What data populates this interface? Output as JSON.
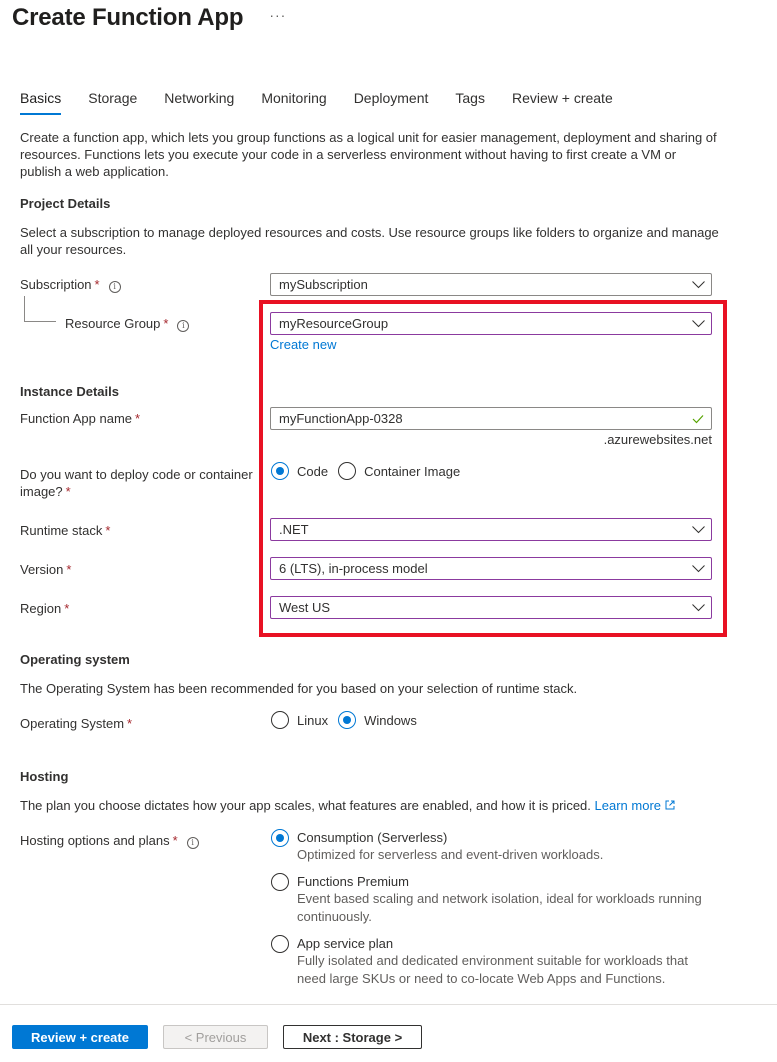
{
  "header": {
    "title": "Create Function App",
    "more_label": "···"
  },
  "tabs": [
    {
      "label": "Basics",
      "active": true
    },
    {
      "label": "Storage"
    },
    {
      "label": "Networking"
    },
    {
      "label": "Monitoring"
    },
    {
      "label": "Deployment"
    },
    {
      "label": "Tags"
    },
    {
      "label": "Review + create"
    }
  ],
  "intro": "Create a function app, which lets you group functions as a logical unit for easier management, deployment and sharing of resources. Functions lets you execute your code in a serverless environment without having to first create a VM or publish a web application.",
  "project": {
    "heading": "Project Details",
    "description": "Select a subscription to manage deployed resources and costs. Use resource groups like folders to organize and manage all your resources.",
    "subscription_label": "Subscription",
    "subscription_value": "mySubscription",
    "resource_group_label": "Resource Group",
    "resource_group_value": "myResourceGroup",
    "create_new": "Create new"
  },
  "instance": {
    "heading": "Instance Details",
    "app_name_label": "Function App name",
    "app_name_value": "myFunctionApp-0328",
    "app_name_suffix": ".azurewebsites.net",
    "deploy_label": "Do you want to deploy code or container image?",
    "deploy_options": [
      {
        "label": "Code",
        "checked": true
      },
      {
        "label": "Container Image",
        "checked": false
      }
    ],
    "runtime_label": "Runtime stack",
    "runtime_value": ".NET",
    "version_label": "Version",
    "version_value": "6 (LTS), in-process model",
    "region_label": "Region",
    "region_value": "West US"
  },
  "os": {
    "heading": "Operating system",
    "description": "The Operating System has been recommended for you based on your selection of runtime stack.",
    "label": "Operating System",
    "options": [
      {
        "label": "Linux",
        "checked": false
      },
      {
        "label": "Windows",
        "checked": true
      }
    ]
  },
  "hosting": {
    "heading": "Hosting",
    "description": "The plan you choose dictates how your app scales, what features are enabled, and how it is priced.",
    "learn_more": "Learn more",
    "label": "Hosting options and plans",
    "plans": [
      {
        "title": "Consumption (Serverless)",
        "desc": "Optimized for serverless and event-driven workloads.",
        "checked": true
      },
      {
        "title": "Functions Premium",
        "desc": "Event based scaling and network isolation, ideal for workloads running continuously.",
        "checked": false
      },
      {
        "title": "App service plan",
        "desc": "Fully isolated and dedicated environment suitable for workloads that need large SKUs or need to co-locate Web Apps and Functions.",
        "checked": false
      }
    ]
  },
  "footer": {
    "review_create": "Review + create",
    "previous": "< Previous",
    "next": "Next : Storage >"
  },
  "colors": {
    "accent": "#0078d4",
    "highlight": "#e81123",
    "required": "#a4262c",
    "valid": "#57a300"
  }
}
